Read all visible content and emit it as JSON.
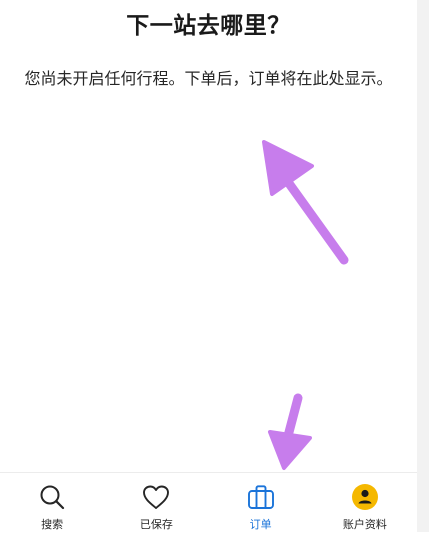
{
  "header": {
    "title": "下一站去哪里？"
  },
  "empty_state": {
    "message": "您尚未开启任何行程。下单后，订单将在此处显示。"
  },
  "tabbar": {
    "items": [
      {
        "label": "搜索",
        "icon": "search-icon",
        "active": false
      },
      {
        "label": "已保存",
        "icon": "heart-icon",
        "active": false
      },
      {
        "label": "订单",
        "icon": "briefcase-icon",
        "active": true
      },
      {
        "label": "账户资料",
        "icon": "account-icon",
        "active": false
      }
    ]
  },
  "colors": {
    "active": "#1a73d9",
    "inactive": "#262626",
    "annotation_arrow": "#c77dec",
    "account_badge": "#f5b800"
  }
}
